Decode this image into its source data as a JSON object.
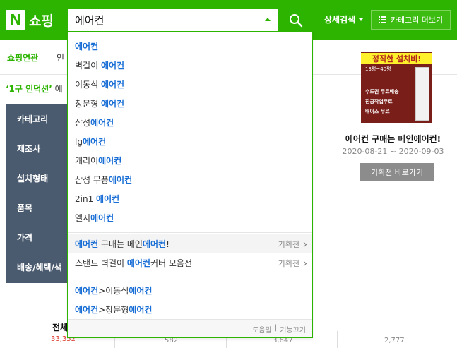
{
  "header": {
    "logo_letter": "N",
    "logo_text": "쇼핑",
    "search_value": "에어컨",
    "detail_search": "상세검색",
    "category_more": "카테고리 더보기"
  },
  "related": {
    "label": "쇼핑연관",
    "first_item": "인"
  },
  "promo_line": {
    "highlight": "‘1구 인덕션’",
    "rest": " 에"
  },
  "filters": [
    "카테고리",
    "제조사",
    "설치형태",
    "품목",
    "가격",
    "배송/혜택/색"
  ],
  "tabs": {
    "all_label": "전체",
    "all_count": "33,352",
    "sub_counts": [
      "582",
      "3,647",
      "2,777"
    ]
  },
  "ad": {
    "banner_title": "정직한 설치비!",
    "banner_sub": "13평~40평",
    "banner_lines": [
      "수도권 무료배송",
      "진공작업무료",
      "배이스 무료"
    ],
    "name": "에어컨 구매는 메인에어컨!",
    "date": "2020-08-21 ~ 2020-09-03",
    "button": "기획전 바로가기"
  },
  "dropdown": {
    "suggestions": [
      {
        "pre": "",
        "kw": "에어컨",
        "post": ""
      },
      {
        "pre": "벽걸이 ",
        "kw": "에어컨",
        "post": ""
      },
      {
        "pre": "이동식 ",
        "kw": "에어컨",
        "post": ""
      },
      {
        "pre": "창문형 ",
        "kw": "에어컨",
        "post": ""
      },
      {
        "pre": "삼성",
        "kw": "에어컨",
        "post": ""
      },
      {
        "pre": "lg",
        "kw": "에어컨",
        "post": ""
      },
      {
        "pre": "캐리어",
        "kw": "에어컨",
        "post": ""
      },
      {
        "pre": "삼성 무풍",
        "kw": "에어컨",
        "post": ""
      },
      {
        "pre": "2in1 ",
        "kw": "에어컨",
        "post": ""
      },
      {
        "pre": "엘지",
        "kw": "에어컨",
        "post": ""
      }
    ],
    "promos": [
      {
        "kw1": "에어컨",
        "mid": " 구매는 메인",
        "kw2": "에어컨",
        "post": "!",
        "tag": "기획전"
      },
      {
        "pre": "스탠드 벽걸이 ",
        "kw": "에어컨",
        "post": "커버 모음전",
        "tag": "기획전"
      }
    ],
    "paths": [
      {
        "kw1": "에어컨",
        "mid": ">이동식",
        "kw2": "에어컨"
      },
      {
        "kw1": "에어컨",
        "mid": ">창문형",
        "kw2": "에어컨"
      }
    ],
    "footer_help": "도움말",
    "footer_sep": "|",
    "footer_off": "기능끄기"
  }
}
